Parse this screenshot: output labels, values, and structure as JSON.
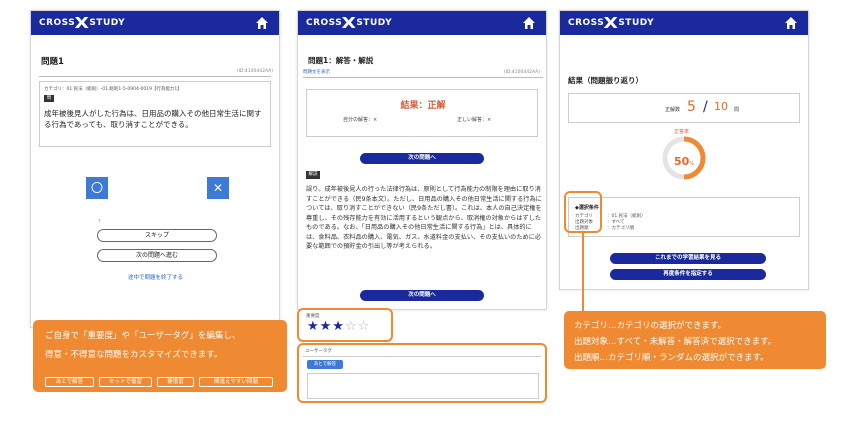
{
  "brand": {
    "left": "CROSS",
    "right": "STUDY"
  },
  "panel1": {
    "title": "問題1",
    "id": "(ID:4100442AA)",
    "category": "カテゴリ：01.民法（総則）-01.総則1-5-0904-0019【行為能力1】",
    "tag": "問",
    "question": "成年被後見人がした行為は、日用品の購入その他日常生活に関する行為であっても、取り消すことができる。",
    "btn_o": "〇",
    "btn_x": "✕",
    "help": "?",
    "skip": "スキップ",
    "next": "次の問題へ進む",
    "quit": "途中で問題を終了する"
  },
  "panel2": {
    "title": "問題1：解答・解説",
    "show_text": "問題文を表示",
    "id": "(ID:4100442AA)",
    "result": "結果：正解",
    "your_answer": "自分の解答：×",
    "correct_answer": "正しい解答：×",
    "next1": "次の問題へ",
    "kaisetsu": "解説",
    "explanation": "誤り。成年被後見人の行った法律行為は、原則として行為能力の制限を理由に取り消すことができる（民9条本文）。ただし、日用品の購入その他日常生活に関する行為については、取り消すことができない（民9条ただし書）。これは、本人の自己決定権を尊重し、その残存能力を有効に活用するという観点から、取消権の対象からはずしたものである。なお、「日用品の購入その他日常生活に関する行為」とは、具体的には、食料品、衣料品の購入、電気、ガス、水道料金の支払い、その支払いのために必要な範囲での預貯金の引出し等が考えられる。",
    "next2": "次の問題へ",
    "importance_label": "重要度",
    "stars_on": "★★★",
    "stars_off": "☆☆",
    "user_tag_label": "ユーザータグ",
    "user_tag_btn": "あとで解答"
  },
  "panel3": {
    "title": "結果（問題振り返り）",
    "score_label": "正解数",
    "score": "5",
    "slash": "/",
    "total": "10",
    "unit": "問",
    "rate_label": "正答率",
    "rate_value": "50",
    "rate_unit": "%",
    "rate_fraction": 0.5,
    "cond_title": "◆選択条件",
    "cond_rows": [
      {
        "k": "カテゴリ",
        "v": "：01.民法（総則）"
      },
      {
        "k": "出題対象",
        "v": "：すべて"
      },
      {
        "k": "出題順",
        "v": "：カテゴリ順"
      }
    ],
    "btn_history": "これまでの学習結果を見る",
    "btn_redo": "再度条件を指定する"
  },
  "callout_left": {
    "line1": "ご自身で「重要度」や「ユーザータグ」を編集し、",
    "line2": "得意・不得意な問題をカスタマイズできます。",
    "chips": [
      "あとで解答",
      "セットで復習",
      "要復習",
      "間違えやすい問題"
    ]
  },
  "callout_right": {
    "line1": "カテゴリ…カテゴリの選択ができます。",
    "line2": "出題対象…すべて・未解答・解答済で選択できます。",
    "line3": "出題順…カテゴリ順・ランダムの選択ができます。"
  },
  "colors": {
    "navy": "#1a2a9c",
    "orange": "#ef8a32",
    "blue": "#3d7ad6"
  }
}
